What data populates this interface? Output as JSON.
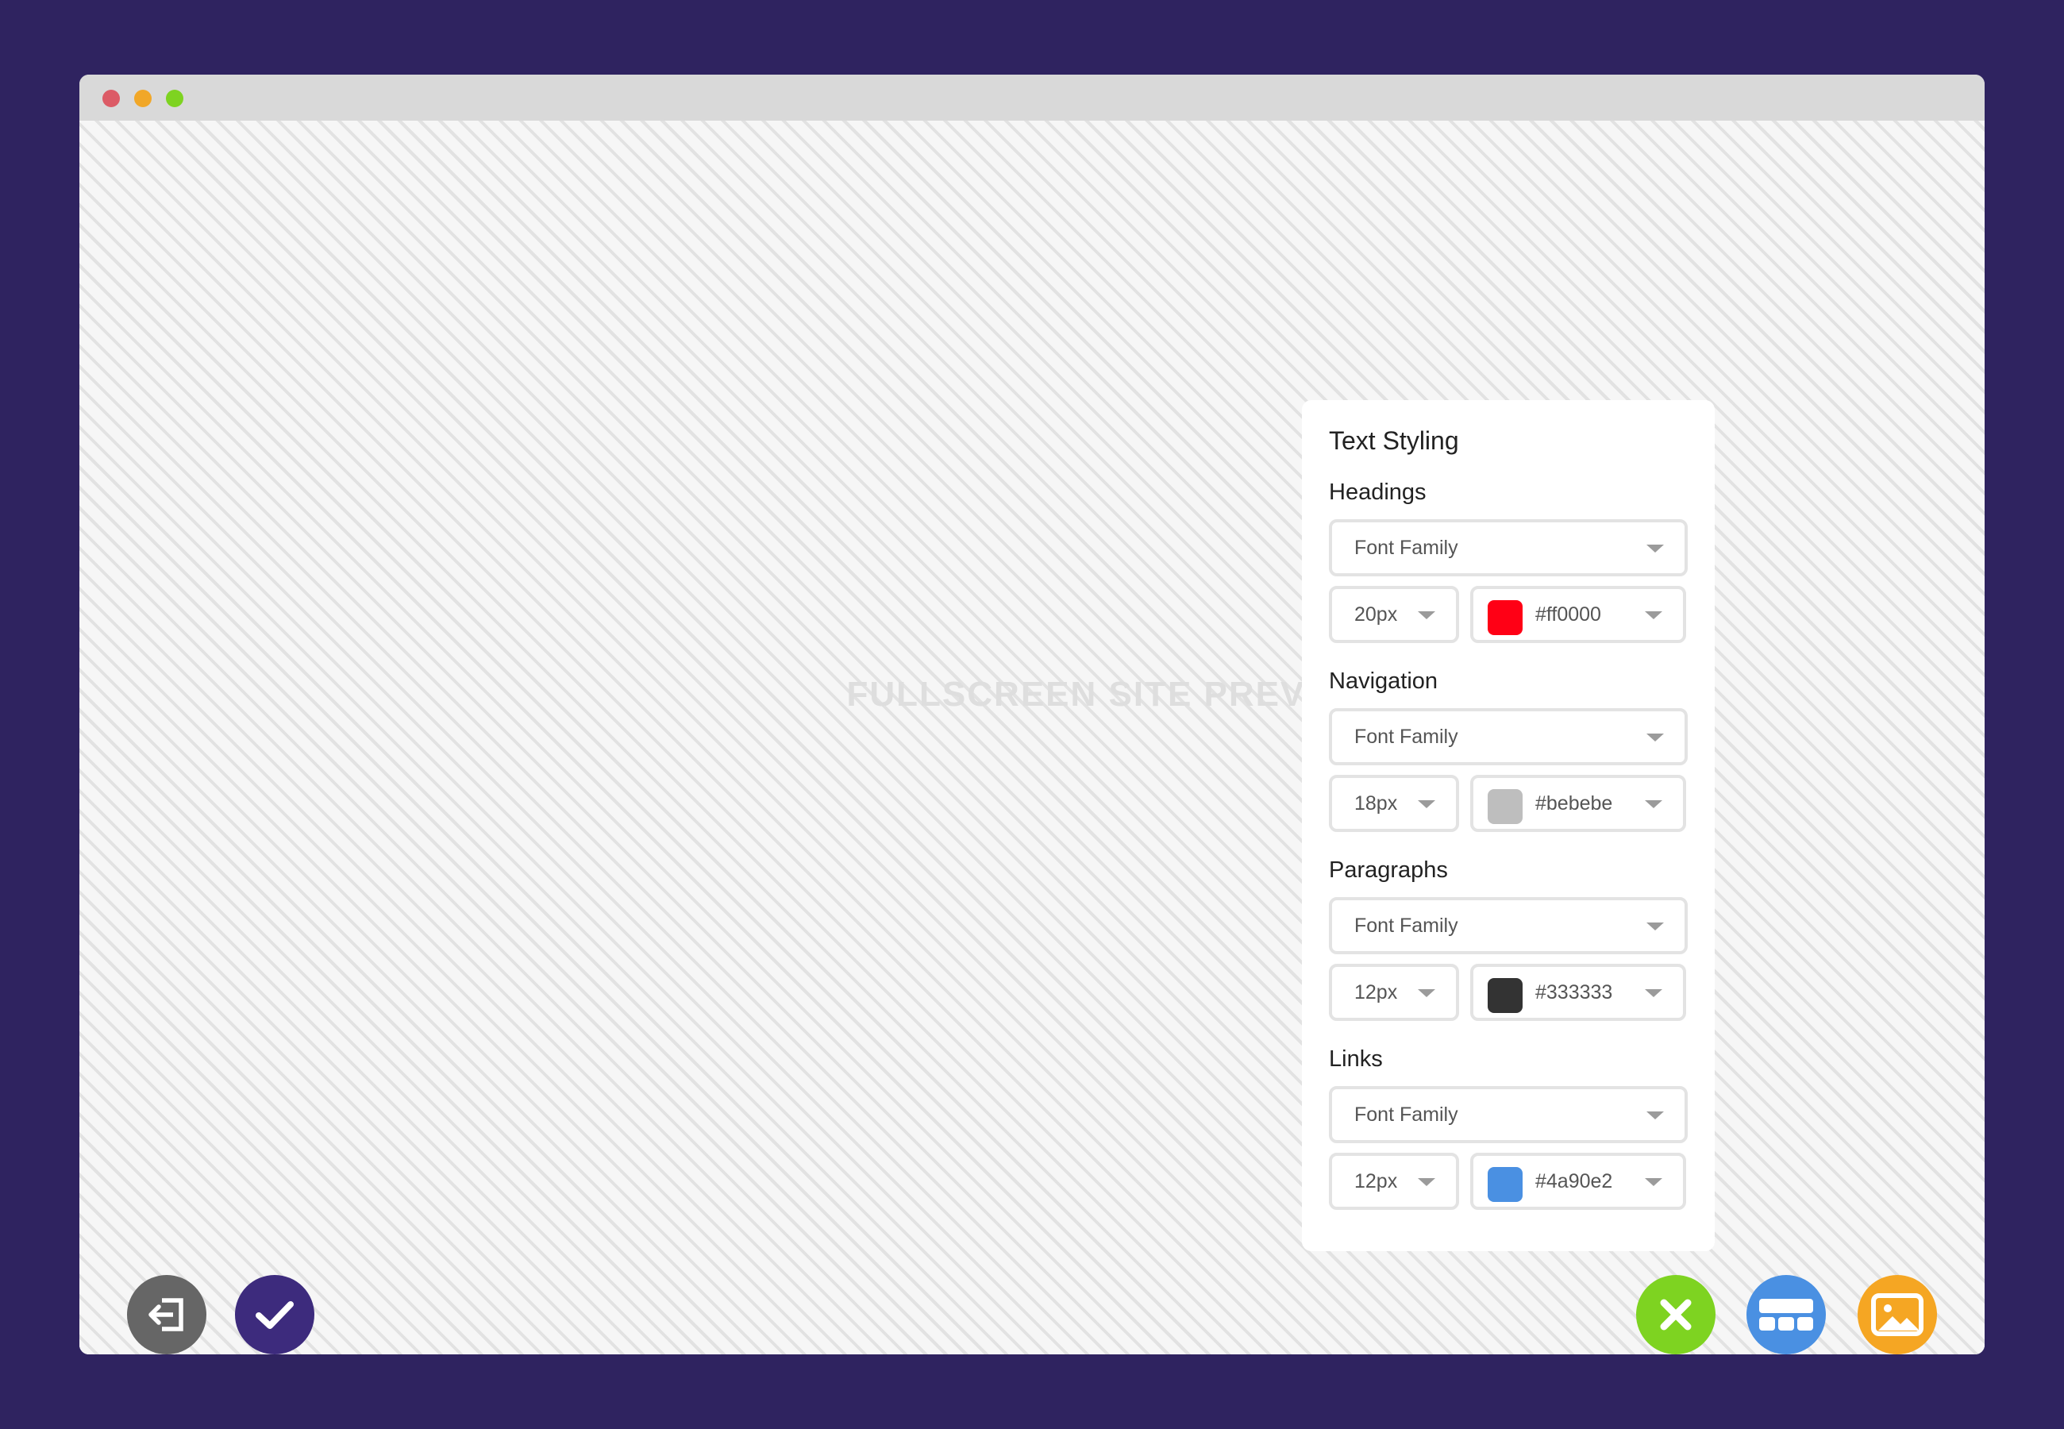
{
  "preview": {
    "label": "FULLSCREEN SITE PREVIEW"
  },
  "panel": {
    "title": "Text Styling",
    "sections": [
      {
        "label": "Headings",
        "font_family": "Font Family",
        "size": "20px",
        "color_text": "#ff0000",
        "swatch": "#ff0015"
      },
      {
        "label": "Navigation",
        "font_family": "Font Family",
        "size": "18px",
        "color_text": "#bebebe",
        "swatch": "#bebebe"
      },
      {
        "label": "Paragraphs",
        "font_family": "Font Family",
        "size": "12px",
        "color_text": "#333333",
        "swatch": "#333333"
      },
      {
        "label": "Links",
        "font_family": "Font Family",
        "size": "12px",
        "color_text": "#4a90e2",
        "swatch": "#4a90e2"
      }
    ]
  },
  "buttons": {
    "exit": {
      "icon": "exit-icon",
      "color": "#666666"
    },
    "confirm": {
      "icon": "checkmark-icon",
      "color": "#3d2b7d"
    },
    "close": {
      "icon": "close-icon",
      "color": "#7ed321"
    },
    "layout": {
      "icon": "layout-icon",
      "color": "#4a90e2"
    },
    "image": {
      "icon": "image-icon",
      "color": "#f5a623"
    }
  },
  "window_controls": {
    "close_color": "#dc5b66",
    "minimize_color": "#f1a728",
    "maximize_color": "#7ed321"
  }
}
